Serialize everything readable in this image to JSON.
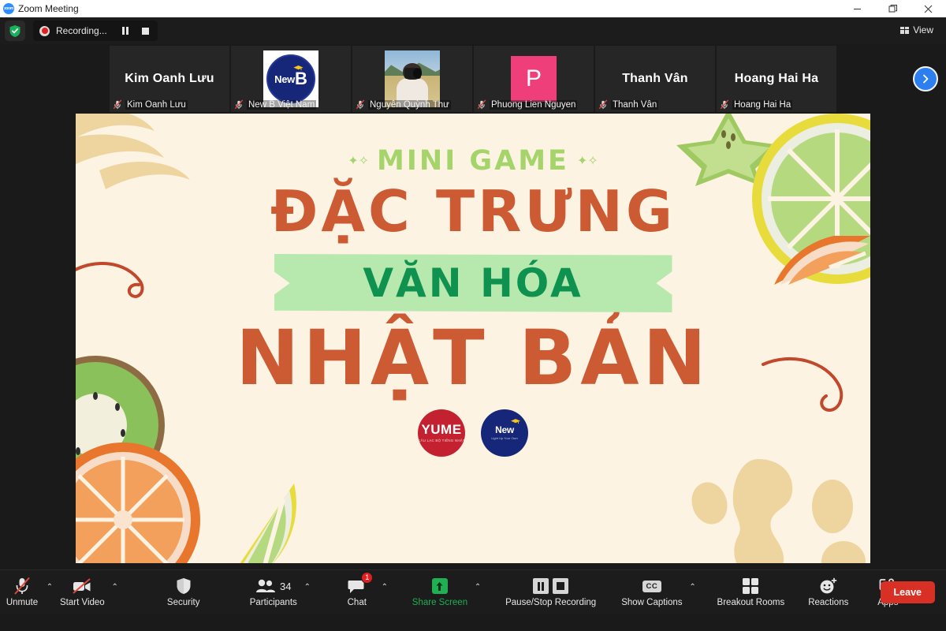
{
  "window": {
    "title": "Zoom Meeting",
    "logo_icon": "zoom-logo-icon",
    "minimize_label": "Minimize",
    "maximize_label": "Maximize",
    "close_label": "Close"
  },
  "topbar": {
    "encryption_icon": "green-shield-icon",
    "recording_label": "Recording...",
    "pause_recording_label": "Pause Recording",
    "stop_recording_label": "Stop Recording",
    "view_label": "View",
    "view_icon": "grid-view-icon"
  },
  "filmstrip": {
    "next_page_icon": "chevron-right-icon",
    "participants": [
      {
        "name": "Kim Oanh Lưu",
        "display": "Kim Oanh Lưu",
        "avatar_type": "name",
        "muted": true
      },
      {
        "name": "New B Việt Nam",
        "display": "New B Việt Nam",
        "avatar_type": "logo",
        "logo_text": "New",
        "logo_letter": "B",
        "logo_tagline": "Light Up Your Own",
        "muted": true
      },
      {
        "name": "Nguyễn Quỳnh Thư",
        "display": "Nguyễn Quỳnh Thư",
        "avatar_type": "photo",
        "muted": true
      },
      {
        "name": "Phuong Lien Nguyen",
        "display": "Phuong Lien Nguyen",
        "avatar_type": "initial",
        "initial": "P",
        "avatar_color": "#ef3f7b",
        "muted": true
      },
      {
        "name": "Thanh Vân",
        "display": "Thanh Vân",
        "avatar_type": "name",
        "muted": true
      },
      {
        "name": "Hoang Hai Ha",
        "display": "Hoang Hai Ha",
        "avatar_type": "name",
        "muted": true
      }
    ]
  },
  "slide": {
    "eyebrow": "MINI GAME",
    "title_line1": "ĐẶC TRƯNG",
    "title_line2": "VĂN HÓA",
    "title_line3": "NHẬT BẢN",
    "background_color": "#fdf3e3",
    "accent_orange": "#cc5a32",
    "accent_green_light": "#b7e8ae",
    "accent_green_dark": "#0f9150",
    "accent_green_lime": "#a4d46a",
    "logos": [
      {
        "name": "YUME",
        "text": "YUME",
        "tagline": "CÂU LẠC BỘ TIẾNG NHẬT",
        "color": "#c32130"
      },
      {
        "name": "New B",
        "text": "New",
        "letter": "B",
        "tagline": "Light Up Your Own",
        "color": "#16277a"
      }
    ]
  },
  "toolbar": {
    "unmute_label": "Unmute",
    "unmute_icon": "microphone-muted-icon",
    "start_video_label": "Start Video",
    "start_video_icon": "video-muted-icon",
    "security_label": "Security",
    "security_icon": "shield-icon",
    "participants_label": "Participants",
    "participants_icon": "people-icon",
    "participants_count": "34",
    "chat_label": "Chat",
    "chat_icon": "chat-bubble-icon",
    "chat_badge": "1",
    "share_screen_label": "Share Screen",
    "share_screen_icon": "share-screen-icon",
    "recording_label": "Pause/Stop Recording",
    "captions_label": "Show Captions",
    "captions_icon": "cc-icon",
    "breakout_label": "Breakout Rooms",
    "breakout_icon": "breakout-grid-icon",
    "reactions_label": "Reactions",
    "reactions_icon": "smiley-plus-icon",
    "apps_label": "Apps",
    "apps_icon": "apps-icon",
    "leave_label": "Leave",
    "chevron": "⌃"
  }
}
